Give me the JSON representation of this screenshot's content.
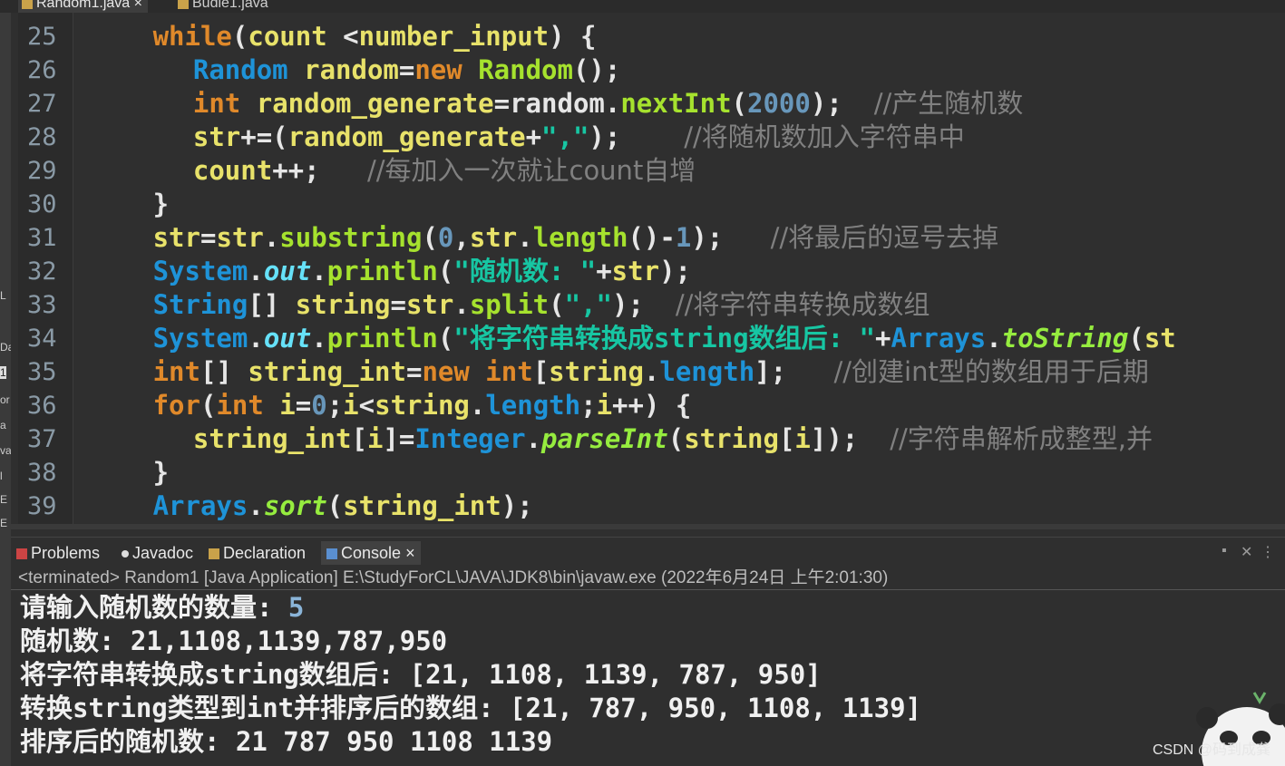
{
  "tabs": [
    {
      "label": "Random1.java",
      "close": "×"
    },
    {
      "label": "Budle1.java"
    }
  ],
  "left_strip": [
    "L",
    "Da",
    "1",
    "or",
    "a",
    "va",
    "l",
    "E",
    "E"
  ],
  "editor": {
    "line_numbers": [
      "25",
      "26",
      "27",
      "28",
      "29",
      "30",
      "31",
      "32",
      "33",
      "34",
      "35",
      "36",
      "37",
      "38",
      "39"
    ],
    "lines": [
      {
        "indent": "        ",
        "parts": [
          [
            "kw",
            "while"
          ],
          [
            "op",
            "("
          ],
          [
            "id",
            "count"
          ],
          [
            "op",
            " <"
          ],
          [
            "id",
            "number_input"
          ],
          [
            "op",
            ") {"
          ]
        ]
      },
      {
        "indent": "            ",
        "parts": [
          [
            "ty",
            "Random"
          ],
          [
            "op",
            " "
          ],
          [
            "id",
            "random"
          ],
          [
            "op",
            "="
          ],
          [
            "kw",
            "new"
          ],
          [
            "op",
            " "
          ],
          [
            "me",
            "Random"
          ],
          [
            "op",
            "();"
          ]
        ]
      },
      {
        "indent": "            ",
        "parts": [
          [
            "kw",
            "int"
          ],
          [
            "op",
            " "
          ],
          [
            "id",
            "random_generate"
          ],
          [
            "op",
            "=random."
          ],
          [
            "me",
            "nextInt"
          ],
          [
            "op",
            "("
          ],
          [
            "nu",
            "2000"
          ],
          [
            "op",
            ");  "
          ],
          [
            "cm",
            "//产生随机数"
          ]
        ]
      },
      {
        "indent": "            ",
        "parts": [
          [
            "id",
            "str"
          ],
          [
            "op",
            "+=("
          ],
          [
            "id",
            "random_generate"
          ],
          [
            "op",
            "+"
          ],
          [
            "st",
            "\",\""
          ],
          [
            "op",
            ");    "
          ],
          [
            "cm",
            "//将随机数加入字符串中"
          ]
        ]
      },
      {
        "indent": "            ",
        "parts": [
          [
            "id",
            "count"
          ],
          [
            "op",
            "++;   "
          ],
          [
            "cm",
            "//每加入一次就让count自增"
          ]
        ]
      },
      {
        "indent": "        ",
        "parts": [
          [
            "op",
            "}"
          ]
        ]
      },
      {
        "indent": "        ",
        "parts": [
          [
            "id",
            "str"
          ],
          [
            "op",
            "="
          ],
          [
            "id",
            "str"
          ],
          [
            "op",
            "."
          ],
          [
            "me",
            "substring"
          ],
          [
            "op",
            "("
          ],
          [
            "nu",
            "0"
          ],
          [
            "op",
            ","
          ],
          [
            "id",
            "str"
          ],
          [
            "op",
            "."
          ],
          [
            "me",
            "length"
          ],
          [
            "op",
            "()-"
          ],
          [
            "nu",
            "1"
          ],
          [
            "op",
            ");   "
          ],
          [
            "cm",
            "//将最后的逗号去掉"
          ]
        ]
      },
      {
        "indent": "        ",
        "parts": [
          [
            "ty",
            "System"
          ],
          [
            "op",
            "."
          ],
          [
            "fl",
            "out"
          ],
          [
            "op",
            "."
          ],
          [
            "me",
            "println"
          ],
          [
            "op",
            "("
          ],
          [
            "st",
            "\"随机数: \""
          ],
          [
            "op",
            "+"
          ],
          [
            "id",
            "str"
          ],
          [
            "op",
            ");"
          ]
        ]
      },
      {
        "indent": "        ",
        "parts": [
          [
            "ty",
            "String"
          ],
          [
            "op",
            "[] "
          ],
          [
            "id",
            "string"
          ],
          [
            "op",
            "="
          ],
          [
            "id",
            "str"
          ],
          [
            "op",
            "."
          ],
          [
            "me",
            "split"
          ],
          [
            "op",
            "("
          ],
          [
            "st",
            "\",\""
          ],
          [
            "op",
            ");  "
          ],
          [
            "cm",
            "//将字符串转换成数组"
          ]
        ]
      },
      {
        "indent": "        ",
        "parts": [
          [
            "ty",
            "System"
          ],
          [
            "op",
            "."
          ],
          [
            "fl",
            "out"
          ],
          [
            "op",
            "."
          ],
          [
            "me",
            "println"
          ],
          [
            "op",
            "("
          ],
          [
            "st",
            "\"将字符串转换成string数组后: \""
          ],
          [
            "op",
            "+"
          ],
          [
            "ty",
            "Arrays"
          ],
          [
            "op",
            "."
          ],
          [
            "sm",
            "toString"
          ],
          [
            "op",
            "("
          ],
          [
            "id",
            "st"
          ]
        ]
      },
      {
        "indent": "        ",
        "parts": [
          [
            "kw",
            "int"
          ],
          [
            "op",
            "[] "
          ],
          [
            "id",
            "string_int"
          ],
          [
            "op",
            "="
          ],
          [
            "kw",
            "new"
          ],
          [
            "op",
            " "
          ],
          [
            "kw",
            "int"
          ],
          [
            "op",
            "["
          ],
          [
            "id",
            "string"
          ],
          [
            "op",
            "."
          ],
          [
            "ty",
            "length"
          ],
          [
            "op",
            "];   "
          ],
          [
            "cm",
            "//创建int型的数组用于后期"
          ]
        ]
      },
      {
        "indent": "        ",
        "parts": [
          [
            "kw",
            "for"
          ],
          [
            "op",
            "("
          ],
          [
            "kw",
            "int"
          ],
          [
            "op",
            " "
          ],
          [
            "id",
            "i"
          ],
          [
            "op",
            "="
          ],
          [
            "nu",
            "0"
          ],
          [
            "op",
            ";"
          ],
          [
            "id",
            "i"
          ],
          [
            "op",
            "<"
          ],
          [
            "id",
            "string"
          ],
          [
            "op",
            "."
          ],
          [
            "ty",
            "length"
          ],
          [
            "op",
            ";"
          ],
          [
            "id",
            "i"
          ],
          [
            "op",
            "++) {"
          ]
        ]
      },
      {
        "indent": "            ",
        "parts": [
          [
            "id",
            "string_int"
          ],
          [
            "op",
            "["
          ],
          [
            "id",
            "i"
          ],
          [
            "op",
            "]="
          ],
          [
            "ty",
            "Integer"
          ],
          [
            "op",
            "."
          ],
          [
            "sm",
            "parseInt"
          ],
          [
            "op",
            "("
          ],
          [
            "id",
            "string"
          ],
          [
            "op",
            "["
          ],
          [
            "id",
            "i"
          ],
          [
            "op",
            "]);  "
          ],
          [
            "cm",
            "//字符串解析成整型,并"
          ]
        ]
      },
      {
        "indent": "        ",
        "parts": [
          [
            "op",
            "}"
          ]
        ]
      },
      {
        "indent": "        ",
        "parts": [
          [
            "ty",
            "Arrays"
          ],
          [
            "op",
            "."
          ],
          [
            "sm",
            "sort"
          ],
          [
            "op",
            "("
          ],
          [
            "id",
            "string_int"
          ],
          [
            "op",
            ");"
          ]
        ]
      }
    ]
  },
  "view_tabs": {
    "problems": "Problems",
    "javadoc": "Javadoc",
    "declaration": "Declaration",
    "console": "Console",
    "console_close": "×"
  },
  "console": {
    "terminated": "<terminated> Random1 [Java Application] E:\\StudyForCL\\JAVA\\JDK8\\bin\\javaw.exe (2022年6月24日 上午2:01:30)",
    "prompt": "请输入随机数的数量: ",
    "input": "5",
    "outputs": [
      "随机数: 21,1108,1139,787,950",
      "将字符串转换成string数组后: [21, 1108, 1139, 787, 950]",
      "转换string类型到int并排序后的数组: [21, 787, 950, 1108, 1139]",
      "排序后的随机数: 21 787 950 1108 1139"
    ]
  },
  "watermark": "CSDN @码到成龚",
  "colors": {
    "keyword": "#e0892a",
    "type": "#1e93d8",
    "identifier": "#e8e26a",
    "method": "#a6e22e",
    "string": "#17c6a3",
    "comment": "#808080",
    "number": "#6897bb",
    "background": "#2f2f2f"
  }
}
